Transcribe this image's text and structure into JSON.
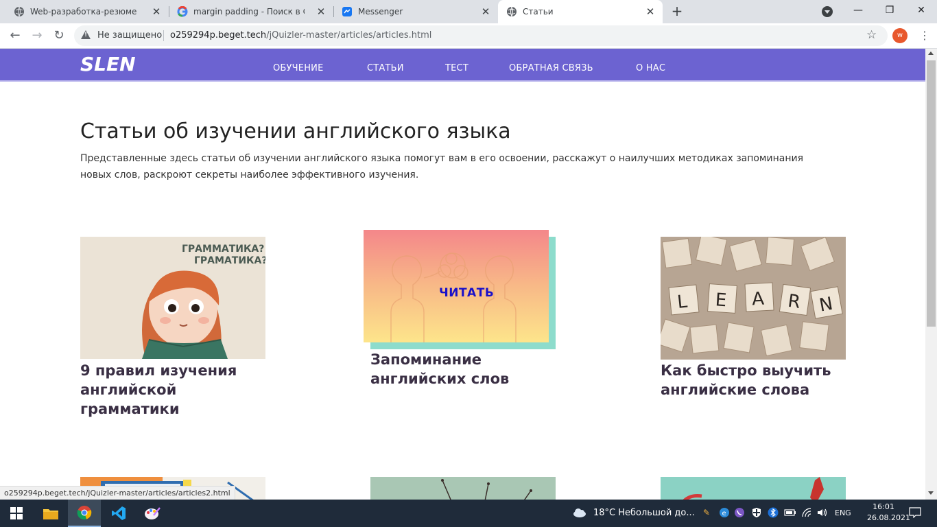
{
  "browser": {
    "tabs": [
      {
        "label": "Web-разработка-резюме",
        "icon": "globe-icon"
      },
      {
        "label": "margin padding - Поиск в Google",
        "icon": "google-icon"
      },
      {
        "label": "Messenger",
        "icon": "messenger-icon"
      },
      {
        "label": "Статьи",
        "icon": "globe-icon",
        "active": true
      }
    ],
    "security_label": "Не защищено",
    "url_host": "o259294p.beget.tech",
    "url_path": "/jQuizler-master/articles/articles.html",
    "avatar_letter": "w"
  },
  "site": {
    "logo": "SLEN",
    "nav": [
      "ОБУЧЕНИЕ",
      "СТАТЬИ",
      "ТЕСТ",
      "ОБРАТНАЯ СВЯЗЬ",
      "О НАС"
    ],
    "title": "Статьи об изучении английского языка",
    "intro": "Представленные здесь статьи об изучении английского языка помогут вам в его освоении, расскажут о наилучших методиках запоминания новых слов, раскроют секреты наиболее эффективного изучения.",
    "cards": [
      {
        "title": "9 правил изучения английской грамматики",
        "image_text": "ГРАММАТИКА? ГРАМАТИКА?"
      },
      {
        "title": "Запоминание английских слов",
        "overlay_label": "ЧИТАТЬ"
      },
      {
        "title": "Как быстро выучить английские слова",
        "image_text": "L E A R N"
      }
    ]
  },
  "statusbar": {
    "url": "o259294p.beget.tech/jQuizler-master/articles/articles2.html"
  },
  "taskbar": {
    "weather": "18°C  Небольшой до...",
    "lang": "ENG",
    "time": "16:01",
    "date": "26.08.2021"
  },
  "colors": {
    "header": "#6c63d1",
    "card_shadow": "#8ddccc",
    "read_label": "#1a11c9"
  }
}
